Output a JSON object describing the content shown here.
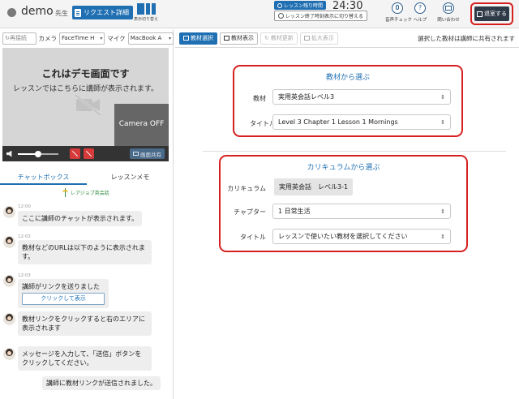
{
  "header": {
    "user_name": "demo",
    "role": "先生",
    "request_button": "リクエスト詳細",
    "layout_toggle_label": "表示切り替え",
    "remaining_badge": "レッスン残り時間",
    "timer": "24:30",
    "switch_display_button": "レッスン終了時刻表示に切り替える",
    "voice_check": "音声チェック",
    "help": "ヘルプ",
    "contact": "問い合わせ",
    "exit_button": "退室する"
  },
  "devices": {
    "reconnect": "再接続",
    "camera_label": "カメラ",
    "camera_value": "FaceTime H",
    "mic_label": "マイク",
    "mic_value": "MacBook A"
  },
  "video": {
    "title": "これはデモ画面です",
    "subtitle": "レッスンではこちらに講師が表示されます。",
    "self_view": "Camera OFF",
    "volume_level": 0.5,
    "share_button": "画面共有"
  },
  "tabs": [
    "チャットボックス",
    "レッスンメモ"
  ],
  "chat": {
    "logo_text": "レアジョブ英会話",
    "messages": [
      {
        "time": "12:00",
        "text": "ここに講師のチャットが表示されます。"
      },
      {
        "time": "12:02",
        "text": "教材などのURLは以下のように表示されます。"
      },
      {
        "time": "12:03",
        "text": "講師がリンクを送りました",
        "link": "クリックして表示"
      },
      {
        "time": "",
        "text": "教材リンクをクリックすると右のエリアに表示されます"
      },
      {
        "time": "",
        "text": "メッセージを入力して、「送信」ボタンをクリックしてください。"
      }
    ],
    "system_message": "講師に教材リンクが送信されました。"
  },
  "toolbar": {
    "select_material": "教材選択",
    "view_material": "教材表示",
    "update_material": "教材更新",
    "zoom": "拡大表示",
    "note": "選択した教材は講師に共有されます"
  },
  "material_section": {
    "title": "教材から選ぶ",
    "material_label": "教材",
    "material_value": "実用英会話レベル3",
    "title_label": "タイトル",
    "title_value": "Level 3 Chapter 1 Lesson 1 Mornings"
  },
  "curriculum_section": {
    "title": "カリキュラムから選ぶ",
    "curriculum_label": "カリキュラム",
    "curriculum_value": "実用英会話　レベル3-1",
    "chapter_label": "チャプター",
    "chapter_value": "1 日常生活",
    "title_label": "タイトル",
    "title_placeholder": "レッスンで使いたい教材を選択してください"
  }
}
